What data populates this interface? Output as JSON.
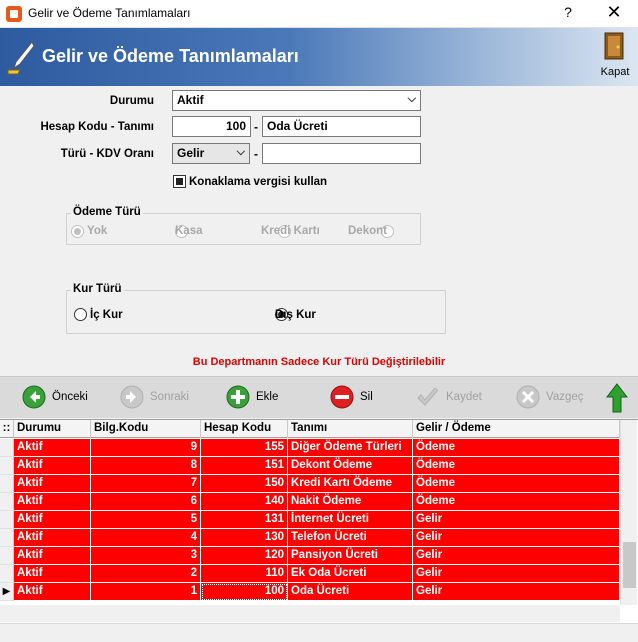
{
  "window": {
    "title": "Gelir ve Ödeme Tanımlamaları",
    "help": "?",
    "close": "✕"
  },
  "header": {
    "title": "Gelir ve Ödeme Tanımlamaları",
    "exit_label": "Kapat"
  },
  "form": {
    "durumu": {
      "label": "Durumu",
      "value": "Aktif"
    },
    "hesap": {
      "label": "Hesap Kodu - Tanımı",
      "code": "100",
      "dash": "-",
      "name": "Oda Ücreti"
    },
    "turu": {
      "label": "Türü - KDV Oranı",
      "value": "Gelir",
      "dash": "-",
      "kdv": ""
    },
    "konaklama": {
      "label": "Konaklama vergisi kullan",
      "checked": true
    }
  },
  "odeme_turu": {
    "title": "Ödeme Türü",
    "options": [
      "Yok",
      "Kasa",
      "Kredi Kartı",
      "Dekont"
    ],
    "selected": "Yok"
  },
  "kur_turu": {
    "title": "Kur Türü",
    "options": [
      "İç Kur",
      "Dış Kur"
    ],
    "selected": "Dış Kur"
  },
  "warning": "Bu Departmanın Sadece Kur Türü Değiştirilebilir",
  "toolbar": {
    "onceki": "Önceki",
    "sonraki": "Sonraki",
    "ekle": "Ekle",
    "sil": "Sil",
    "kaydet": "Kaydet",
    "vazgec": "Vazgeç"
  },
  "grid": {
    "indicator": "::",
    "columns": [
      "Durumu",
      "Bilg.Kodu",
      "Hesap Kodu",
      "Tanımı",
      "Gelir / Ödeme"
    ],
    "rows": [
      [
        "Aktif",
        "9",
        "155",
        "Diğer Ödeme Türleri",
        "Ödeme"
      ],
      [
        "Aktif",
        "8",
        "151",
        "Dekont Ödeme",
        "Ödeme"
      ],
      [
        "Aktif",
        "7",
        "150",
        "Kredi Kartı Ödeme",
        "Ödeme"
      ],
      [
        "Aktif",
        "6",
        "140",
        "Nakit Ödeme",
        "Ödeme"
      ],
      [
        "Aktif",
        "5",
        "131",
        "İnternet Ücreti",
        "Gelir"
      ],
      [
        "Aktif",
        "4",
        "130",
        "Telefon Ücreti",
        "Gelir"
      ],
      [
        "Aktif",
        "3",
        "120",
        "Pansiyon Ücreti",
        "Gelir"
      ],
      [
        "Aktif",
        "2",
        "110",
        "Ek Oda Ücreti",
        "Gelir"
      ],
      [
        "Aktif",
        "1",
        "100",
        "Oda Ücreti",
        "Gelir"
      ]
    ],
    "current_marker": "▶"
  },
  "colors": {
    "row_bg": "#ff0000",
    "row_text": "#ffffff",
    "warning": "#e00000",
    "header_blue": "#2e5aa0"
  }
}
